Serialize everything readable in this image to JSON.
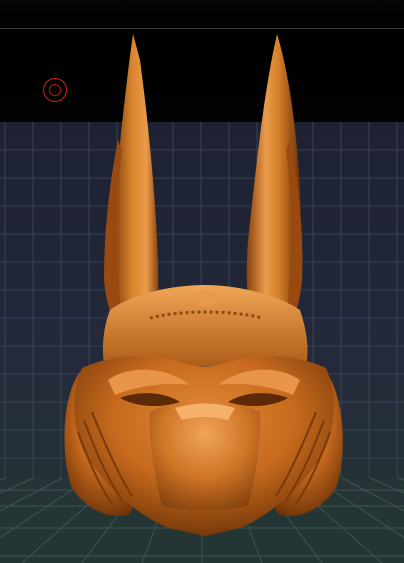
{
  "viewport": {
    "background_top": "#050505",
    "grid_color": "#3b4256",
    "floor_grid_color": "#3e5650",
    "model_color": "#c86a1c",
    "model_highlight": "#f2a862",
    "model_shadow": "#5a2a06"
  },
  "cursor": {
    "icon": "brush-cursor-icon",
    "color": "#d02020"
  },
  "model": {
    "icon": "anubis-mask-sculpt"
  }
}
